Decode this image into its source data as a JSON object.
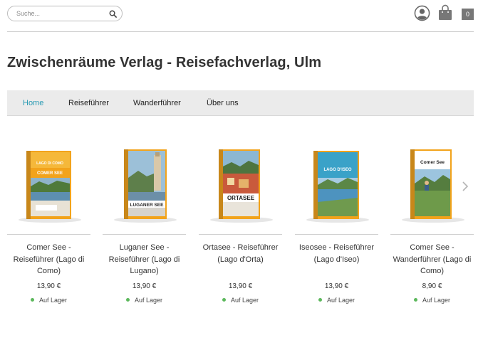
{
  "header": {
    "search_placeholder": "Suche...",
    "cart_count": "0"
  },
  "title": "Zwischenräume Verlag - Reisefachverlag, Ulm",
  "nav": [
    {
      "label": "Home",
      "active": true
    },
    {
      "label": "Reiseführer",
      "active": false
    },
    {
      "label": "Wanderführer",
      "active": false
    },
    {
      "label": "Über uns",
      "active": false
    }
  ],
  "products": [
    {
      "name": "Comer See - Reiseführer (Lago di Como)",
      "price": "13,90 €",
      "stock": "Auf Lager",
      "cover_label": "COMER SEE"
    },
    {
      "name": "Luganer See - Reiseführer (Lago di Lugano)",
      "price": "13,90 €",
      "stock": "Auf Lager",
      "cover_label": "LUGANER SEE"
    },
    {
      "name": "Ortasee - Reiseführer (Lago d'Orta)",
      "price": "13,90 €",
      "stock": "Auf Lager",
      "cover_label": "ORTASEE"
    },
    {
      "name": "Iseosee - Reiseführer (Lago d'Iseo)",
      "price": "13,90 €",
      "stock": "Auf Lager",
      "cover_label": "LAGO D'ISEO"
    },
    {
      "name": "Comer See - Wanderführer (Lago di Como)",
      "price": "8,90 €",
      "stock": "Auf Lager",
      "cover_label": "Comer See"
    }
  ],
  "colors": {
    "accent": "#2a9bb4",
    "nav_bg": "#ebebeb",
    "stock_green": "#5cb85c",
    "cover_orange": "#f2a31b"
  }
}
